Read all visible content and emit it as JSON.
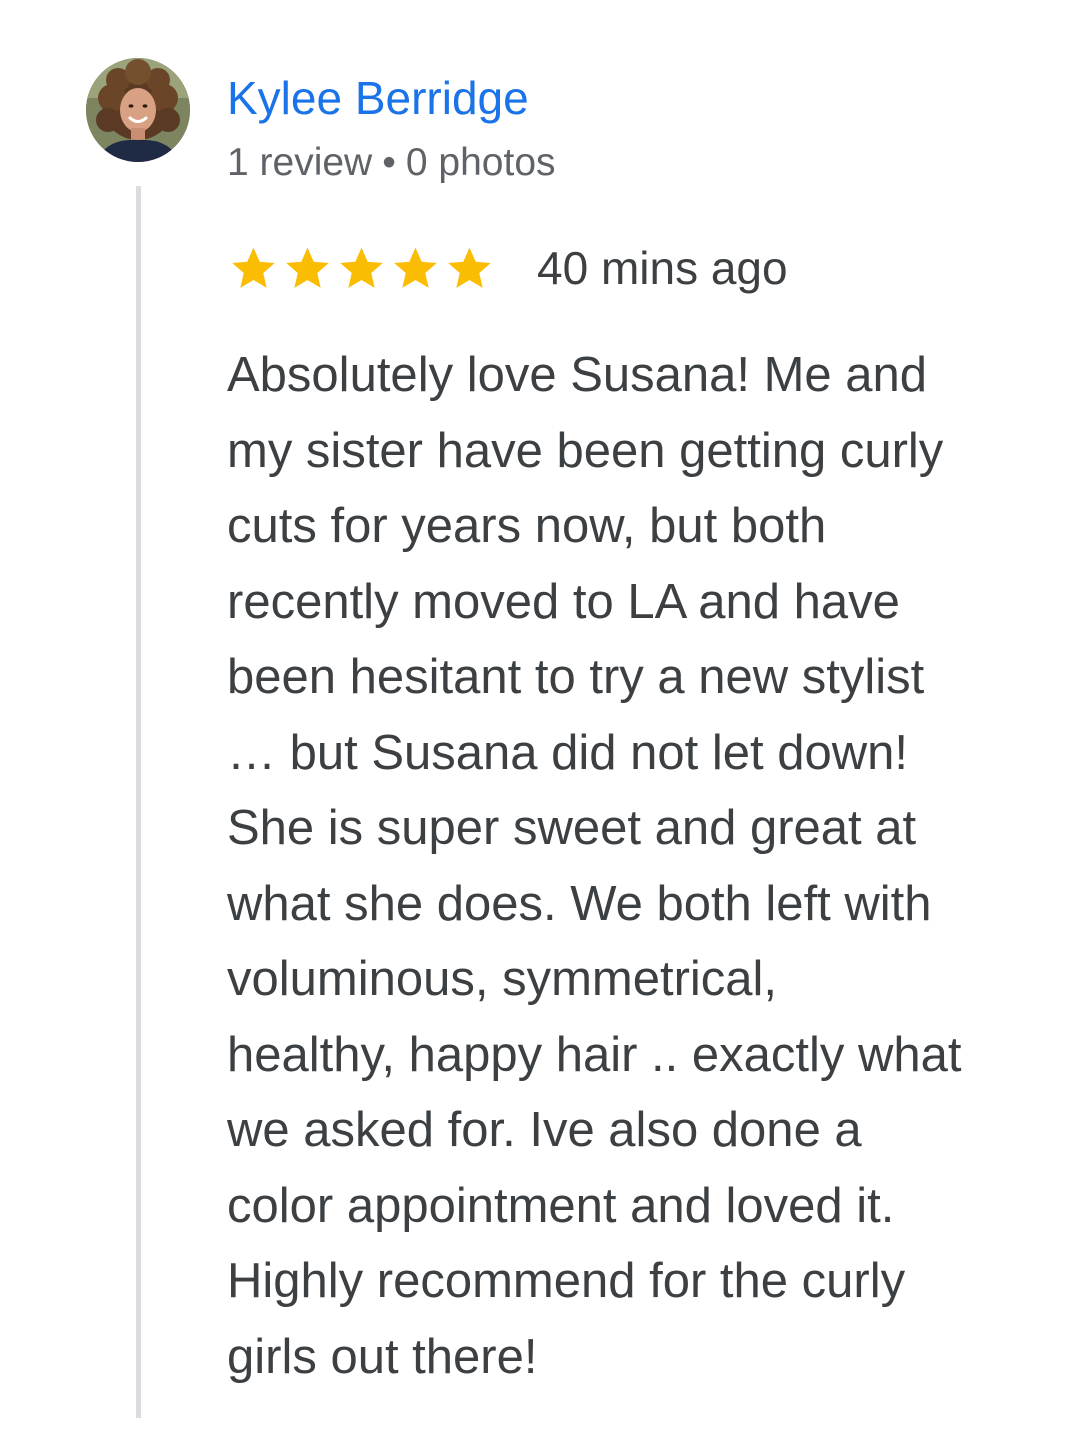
{
  "author": {
    "name": "Kylee Berridge",
    "review_count": "1 review",
    "separator": "•",
    "photo_count": "0 photos",
    "avatar_icon": "user-avatar-photo"
  },
  "rating": {
    "stars": 5,
    "max_stars": 5,
    "star_color": "#fbbc04",
    "time_ago": "40 mins ago"
  },
  "review": {
    "lines": [
      "Absolutely love Susana! Me and",
      "my sister have been getting curly",
      "cuts for years now, but both",
      "recently moved to LA and have",
      "been hesitant to try a new stylist",
      "… but Susana did not let down!",
      "She is super sweet and great at",
      "what she does. We both left with",
      "voluminous, symmetrical,",
      "healthy, happy hair .. exactly what",
      "we asked for. Ive also done a",
      "color appointment and loved it.",
      "Highly recommend for the curly",
      "girls out there!"
    ]
  },
  "colors": {
    "link": "#1a73e8",
    "meta_text": "#5f6368",
    "body_text": "#3c4043",
    "thread_line": "#dadce0"
  }
}
